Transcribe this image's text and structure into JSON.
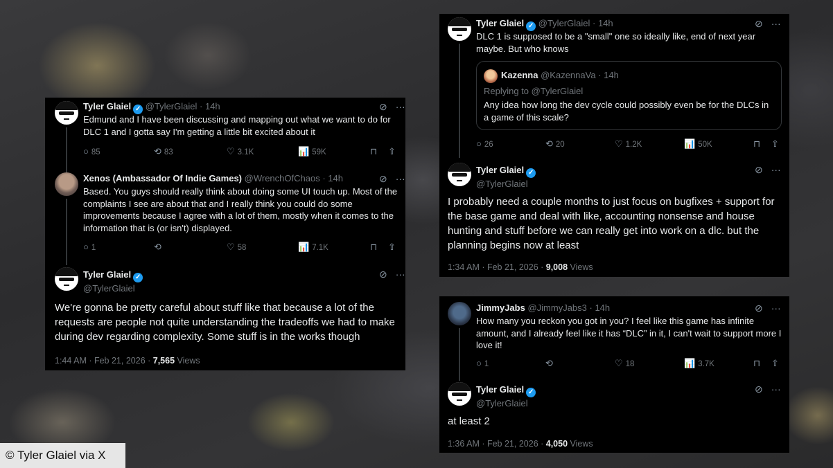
{
  "caption": "© Tyler Glaiel via X",
  "icons": {
    "grok": "⊘",
    "more": "···",
    "reply": "○",
    "repost": "⟲",
    "like": "♡",
    "views": "📊",
    "bookmark": "⊓",
    "share": "⇧",
    "verified": "✓"
  },
  "left_card": {
    "tweet1": {
      "name": "Tyler Glaiel",
      "handle": "@TylerGlaiel",
      "time": "· 14h",
      "text": "Edmund and I have been discussing and mapping out what we want to do for DLC 1 and I gotta say I'm getting a little bit excited about it",
      "replies": "85",
      "reposts": "83",
      "likes": "3.1K",
      "views": "59K"
    },
    "tweet2": {
      "name": "Xenos (Ambassador Of Indie Games)",
      "handle": "@WrenchOfChaos",
      "time": "· 14h",
      "text": "Based. You guys should really think about doing some UI touch up. Most of the complaints I see are about that and I really think you could do some improvements because I agree with a lot of them, mostly when it comes to the information that is (or isn't) displayed.",
      "replies": "1",
      "reposts": "",
      "likes": "58",
      "views": "7.1K"
    },
    "tweet3": {
      "name": "Tyler Glaiel",
      "handle": "@TylerGlaiel",
      "text": "We're gonna be pretty careful about stuff like that because a lot of the requests are people not quite understanding the tradeoffs we had to make during dev regarding complexity. Some stuff is in the works though",
      "timestamp": "1:44 AM · Feb 21, 2026 · ",
      "views_count": "7,565",
      "views_label": "Views"
    }
  },
  "right_top_card": {
    "tweet1": {
      "name": "Tyler Glaiel",
      "handle": "@TylerGlaiel",
      "time": "· 14h",
      "text": "DLC 1 is supposed to be a \"small\" one so ideally like, end of next year maybe. But who knows",
      "quote": {
        "name": "Kazenna",
        "handle": "@KazennaVa",
        "time": "· 14h",
        "replying": "Replying to @TylerGlaiel",
        "text": "Any idea how long the dev cycle could possibly even be for the DLCs in a game of this scale?"
      },
      "replies": "26",
      "reposts": "20",
      "likes": "1.2K",
      "views": "50K"
    },
    "tweet2": {
      "name": "Tyler Glaiel",
      "handle": "@TylerGlaiel",
      "text": "I probably need a couple months to just focus on bugfixes + support for the base game and deal with like, accounting nonsense and house hunting and stuff before we can really get into work on a dlc. but the planning begins now at least",
      "timestamp": "1:34 AM · Feb 21, 2026 · ",
      "views_count": "9,008",
      "views_label": "Views"
    }
  },
  "right_bottom_card": {
    "tweet1": {
      "name": "JimmyJabs",
      "handle": "@JimmyJabs3",
      "time": "· 14h",
      "text": "How many you reckon you got in you? I feel like this game has infinite amount, and I already feel like it has “DLC” in it, I can't wait to support more I love it!",
      "replies": "1",
      "reposts": "",
      "likes": "18",
      "views": "3.7K"
    },
    "tweet2": {
      "name": "Tyler Glaiel",
      "handle": "@TylerGlaiel",
      "text": "at least 2",
      "timestamp": "1:36 AM · Feb 21, 2026 · ",
      "views_count": "4,050",
      "views_label": "Views"
    }
  }
}
